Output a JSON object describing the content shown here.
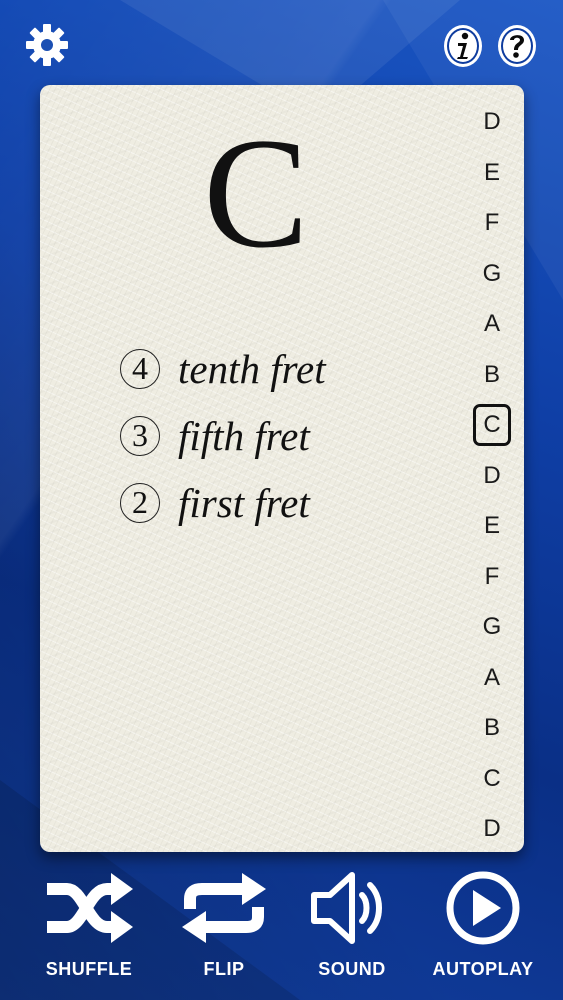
{
  "card": {
    "note": "C",
    "positions": [
      {
        "string": "4",
        "fret": "tenth fret"
      },
      {
        "string": "3",
        "fret": "fifth fret"
      },
      {
        "string": "2",
        "fret": "first fret"
      }
    ],
    "letters": [
      "D",
      "E",
      "F",
      "G",
      "A",
      "B",
      "C",
      "D",
      "E",
      "F",
      "G",
      "A",
      "B",
      "C",
      "D"
    ],
    "selected_letter_index": 6
  },
  "toolbar": {
    "shuffle": "SHUFFLE",
    "flip": "FLIP",
    "sound": "SOUND",
    "autoplay": "AUTOPLAY"
  },
  "icons": {
    "settings": "gear-icon",
    "info": "info-icon",
    "help": "help-icon"
  },
  "colors": {
    "background": "#0d3a9c",
    "card": "#efede2",
    "toolbar_text": "#ffffff"
  }
}
